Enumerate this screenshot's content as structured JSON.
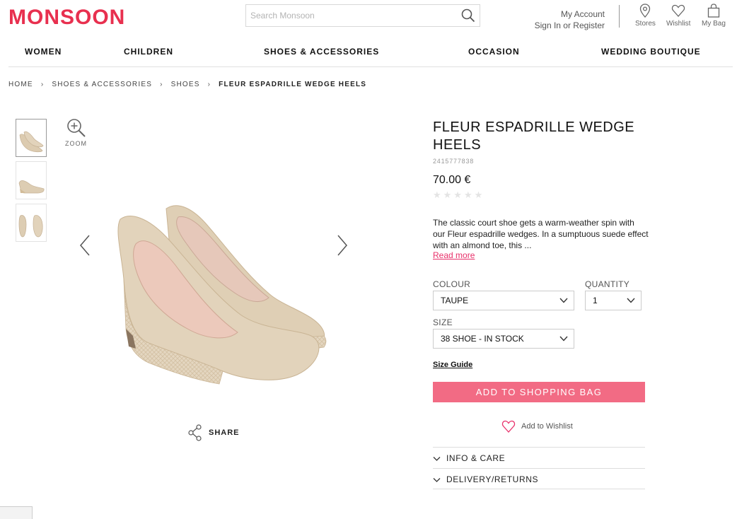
{
  "header": {
    "logo": "MONSOON",
    "search_placeholder": "Search Monsoon",
    "account_line1": "My Account",
    "account_line2": "Sign In or Register",
    "stores": "Stores",
    "wishlist": "Wishlist",
    "bag": "My Bag"
  },
  "nav": [
    "WOMEN",
    "CHILDREN",
    "SHOES & ACCESSORIES",
    "OCCASION",
    "WEDDING BOUTIQUE"
  ],
  "breadcrumb": [
    "HOME",
    "SHOES & ACCESSORIES",
    "SHOES",
    "FLEUR ESPADRILLE WEDGE HEELS"
  ],
  "gallery": {
    "zoom_label": "ZOOM",
    "share_label": "SHARE"
  },
  "product": {
    "title": "FLEUR ESPADRILLE WEDGE HEELS",
    "code": "2415777838",
    "price": "70.00 €",
    "stars": "★★★★★",
    "rating_stars_filled": 0,
    "description": "The classic court shoe gets a warm-weather spin with our Fleur espadrille wedges. In a sumptuous suede effect with an almond toe, this ...",
    "read_more": "Read more",
    "colour_label": "COLOUR",
    "colour_value": "TAUPE",
    "quantity_label": "QUANTITY",
    "quantity_value": "1",
    "size_label": "SIZE",
    "size_value": "38 SHOE - IN STOCK",
    "size_guide": "Size Guide",
    "add_to_bag": "ADD TO SHOPPING BAG",
    "add_to_wishlist": "Add to Wishlist",
    "info_care": "INFO & CARE",
    "delivery_returns": "DELIVERY/RETURNS"
  },
  "colors": {
    "brand": "#e8304f",
    "button": "#f26b84",
    "link": "#e8306a"
  }
}
